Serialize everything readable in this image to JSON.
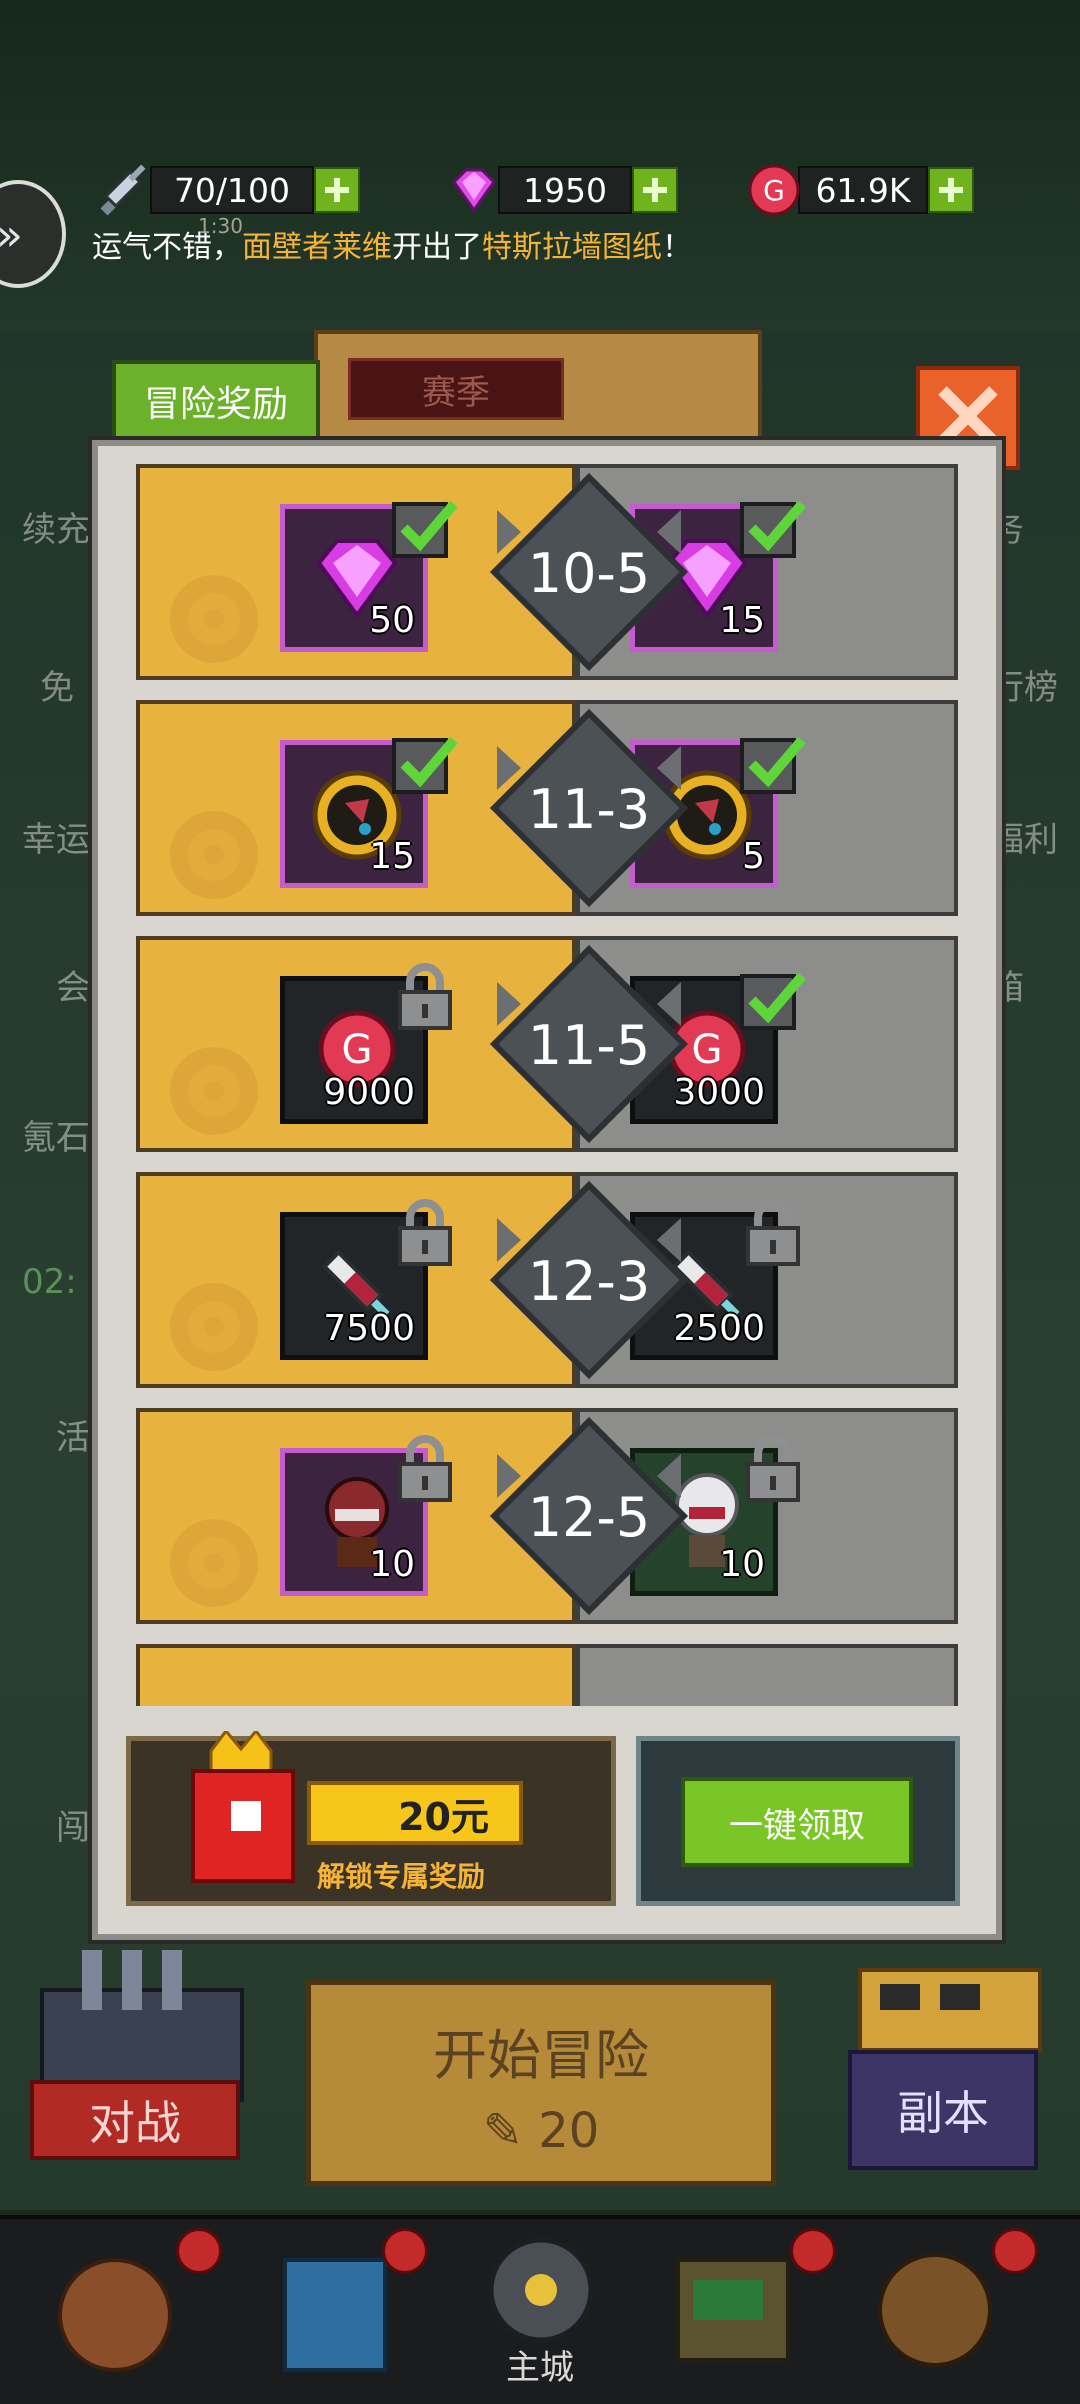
{
  "resources": {
    "stamina": "70/100",
    "gems": "1950",
    "gold": "61.9K"
  },
  "ticker": {
    "prefix": "运气不错，",
    "player": "面壁者莱维",
    "middle": "开出了",
    "item": "特斯拉墙图纸",
    "suffix": "！",
    "time": "1:30"
  },
  "side_labels": {
    "l1": "续充",
    "l2": "免",
    "l3": "幸运",
    "l4": "会",
    "l5": "氪石",
    "l6": "02:",
    "l7": "活",
    "l8": "闯",
    "r1": "务",
    "r2": "行榜",
    "r3": "福利",
    "r4": "箱"
  },
  "tabs": {
    "rewards": "冒险奖励",
    "season": "赛季"
  },
  "rows": [
    {
      "stage": "10-5",
      "left": {
        "icon": "gem-icon",
        "qty": "50",
        "status": "claimed"
      },
      "right": {
        "icon": "gem-icon",
        "qty": "15",
        "status": "claimed"
      }
    },
    {
      "stage": "11-3",
      "left": {
        "icon": "compass-icon",
        "qty": "15",
        "status": "claimed"
      },
      "right": {
        "icon": "compass-icon",
        "qty": "5",
        "status": "claimed"
      }
    },
    {
      "stage": "11-5",
      "left": {
        "icon": "gold-coin-icon",
        "qty": "9000",
        "status": "locked"
      },
      "right": {
        "icon": "gold-coin-icon",
        "qty": "3000",
        "status": "claimed"
      }
    },
    {
      "stage": "12-3",
      "left": {
        "icon": "syringe-icon",
        "qty": "7500",
        "status": "locked"
      },
      "right": {
        "icon": "syringe-icon",
        "qty": "2500",
        "status": "locked"
      }
    },
    {
      "stage": "12-5",
      "left": {
        "icon": "hero-bear-icon",
        "qty": "10",
        "status": "locked"
      },
      "right": {
        "icon": "hero-white-hair-icon",
        "qty": "10",
        "status": "locked"
      }
    }
  ],
  "unlock": {
    "price": "20元",
    "desc": "解锁专属奖励"
  },
  "claim_all": "一键领取",
  "main": {
    "start": "开始冒险",
    "cost": "20",
    "battle": "对战",
    "dungeon": "副本",
    "city": "主城"
  },
  "colors": {
    "accent_green": "#6cb12a",
    "gold_row": "#e8b23f",
    "close_orange": "#e9622a",
    "highlight_text": "#f5b437"
  }
}
